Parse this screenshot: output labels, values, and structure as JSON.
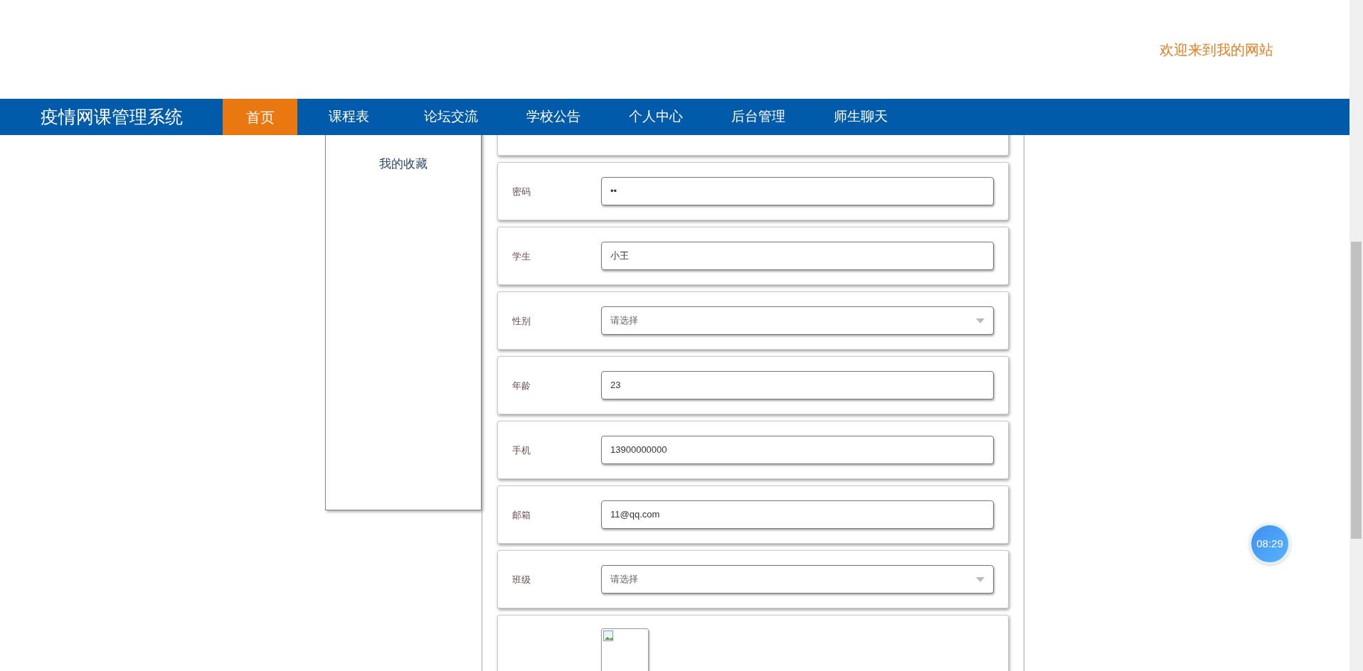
{
  "header": {
    "welcome": "欢迎来到我的网站"
  },
  "nav": {
    "brand": "疫情网课管理系统",
    "tabs": [
      {
        "label": "首页",
        "selected": true
      },
      {
        "label": "课程表",
        "selected": false
      },
      {
        "label": "论坛交流",
        "selected": false
      },
      {
        "label": "学校公告",
        "selected": false
      },
      {
        "label": "个人中心",
        "selected": false
      },
      {
        "label": "后台管理",
        "selected": false
      },
      {
        "label": "师生聊天",
        "selected": false
      }
    ]
  },
  "sidebar": {
    "items": [
      {
        "label": "我的收藏"
      }
    ]
  },
  "form": {
    "fields": [
      {
        "kind": "hidden"
      },
      {
        "kind": "password",
        "label": "密码",
        "value": "••"
      },
      {
        "kind": "text",
        "label": "学生",
        "value": "小王"
      },
      {
        "kind": "select",
        "label": "性别",
        "placeholder": "请选择"
      },
      {
        "kind": "text",
        "label": "年龄",
        "value": "23"
      },
      {
        "kind": "text",
        "label": "手机",
        "value": "13900000000"
      },
      {
        "kind": "text",
        "label": "邮箱",
        "value": "11@qq.com"
      },
      {
        "kind": "select",
        "label": "班级",
        "placeholder": "请选择"
      },
      {
        "kind": "image"
      }
    ]
  },
  "timer": {
    "text": "08:29"
  }
}
